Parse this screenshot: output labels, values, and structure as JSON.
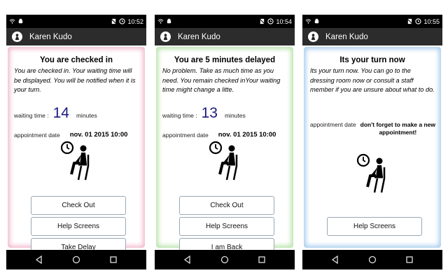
{
  "status_bar": {
    "times": [
      "10:52",
      "10:54",
      "10:55"
    ]
  },
  "app": {
    "user_name": "Karen Kudo"
  },
  "colors": {
    "border_pink": "#f2b9cd",
    "border_green": "#b7e3a9",
    "border_blue": "#a9cdee",
    "wait_number": "#1a1a80"
  },
  "screens": [
    {
      "title": "You are checked in",
      "message": "You are checked in. Your waiting time will be displayed. You will be notified when it is your turn.",
      "waiting_time_label": "waiting time :",
      "waiting_time_value": "14",
      "waiting_time_unit": "minutes",
      "appointment_label": "appointment date",
      "appointment_date": "nov. 01 2015 10:00",
      "buttons": [
        "Check Out",
        "Help Screens",
        "Take Delay"
      ]
    },
    {
      "title": "You are 5 minutes delayed",
      "message": "No problem. Take as much time as you need. You remain checked inYour waiting time might change a litte.",
      "waiting_time_label": "waiting time :",
      "waiting_time_value": "13",
      "waiting_time_unit": "minutes",
      "appointment_label": "appointment date",
      "appointment_date": "nov. 01 2015 10:00",
      "buttons": [
        "Check Out",
        "Help Screens",
        "I am Back"
      ]
    },
    {
      "title": "Its your turn now",
      "message": "Its your turn now. You can go to the dressing room now or consult a staff member if you are unsure about what to do.",
      "appointment_label": "appointment date",
      "reminder": "don't forget to make a new appointment!",
      "buttons": [
        "Help Screens"
      ]
    }
  ],
  "icons": {
    "status_left": [
      "wifi-icon",
      "android-icon"
    ],
    "status_right": [
      "no-sim-icon",
      "alarm-icon"
    ],
    "app": "user-avatar-icon",
    "illustration": "person-waiting-with-clock-icon",
    "nav": [
      "back-icon",
      "home-icon",
      "recents-icon"
    ]
  }
}
